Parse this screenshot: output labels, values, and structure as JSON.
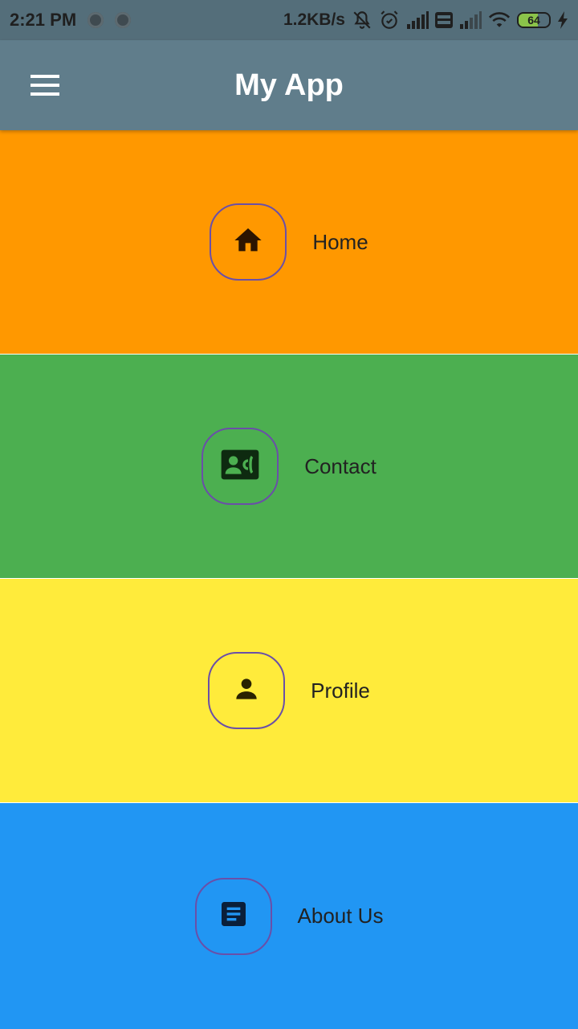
{
  "status_bar": {
    "time": "2:21 PM",
    "network_speed": "1.2KB/s",
    "battery_level": "64",
    "battery_fraction": 0.64,
    "icons": [
      "notification-dot-icon",
      "notification-dot-icon",
      "mute-icon",
      "alarm-icon",
      "signal-icon",
      "volte-icon",
      "signal-icon",
      "wifi-icon",
      "battery-icon",
      "charging-icon"
    ]
  },
  "app_bar": {
    "title": "My App",
    "menu_icon": "hamburger-menu-icon",
    "background": "#607d8b"
  },
  "sections": [
    {
      "label": "Home",
      "icon": "home-icon",
      "background": "#ff9800",
      "icon_color": "#2b1400"
    },
    {
      "label": "Contact",
      "icon": "contact-card-icon",
      "background": "#4caf50",
      "icon_color": "#0e2a10"
    },
    {
      "label": "Profile",
      "icon": "person-icon",
      "background": "#ffeb3b",
      "icon_color": "#2a2200"
    },
    {
      "label": "About Us",
      "icon": "article-icon",
      "background": "#2196f3",
      "icon_color": "#0a1f3a"
    }
  ],
  "colors": {
    "status_bar": "#546e7a",
    "icon_border": "#6a4fa8"
  }
}
